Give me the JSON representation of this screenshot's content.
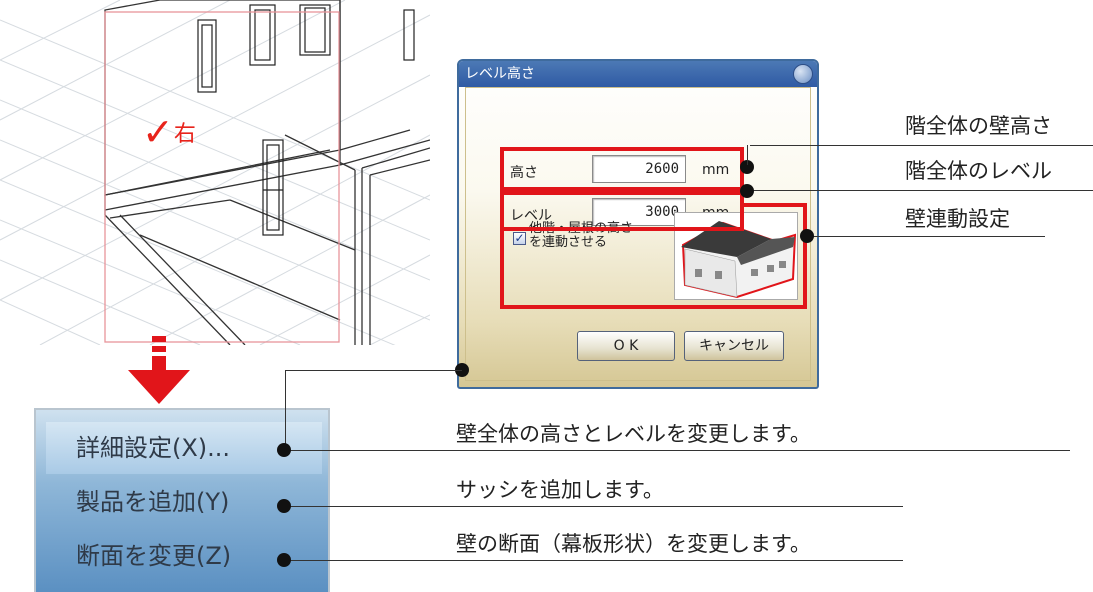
{
  "cad_view": {
    "direction_label": "右"
  },
  "dialog": {
    "title": "レベル高さ",
    "height_label": "高さ",
    "height_value": "2600",
    "level_label": "レベル",
    "level_value": "3000",
    "unit": "mm",
    "link_checkbox_label": "他階・屋根の高さを連動させる",
    "link_checked": true,
    "ok_label": "O K",
    "cancel_label": "キャンセル"
  },
  "callouts": {
    "wall_height": "階全体の壁高さ",
    "level": "階全体のレベル",
    "wall_link": "壁連動設定",
    "menu_detail": "壁全体の高さとレベルを変更します。",
    "menu_add": "サッシを追加します。",
    "menu_section": "壁の断面（幕板形状）を変更します。"
  },
  "context_menu": {
    "items": [
      {
        "label": "詳細設定(X)..."
      },
      {
        "label": "製品を追加(Y)"
      },
      {
        "label": "断面を変更(Z)"
      }
    ]
  },
  "colors": {
    "highlight_red": "#e1151a",
    "dialog_title": "#2f5aa4",
    "menu_blue": "#5b90c2"
  }
}
